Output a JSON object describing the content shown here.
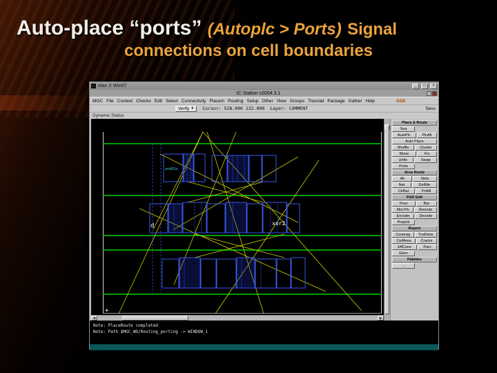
{
  "slide": {
    "title": {
      "main": "Auto-place “ports”",
      "menu_path": "(Autoplc > Ports)",
      "tail": "Signal",
      "line2": "connections on cell boundaries"
    }
  },
  "window": {
    "wm": {
      "title": "elan  X Win07",
      "minimize": "_",
      "maximize": "□",
      "close": "×"
    },
    "app_title": "IC Station v2004.3.1",
    "menu": {
      "items": [
        "MGC",
        "File",
        "Context",
        "Checks",
        "Edit",
        "Select",
        "Connectivity",
        "Placem",
        "Routing",
        "Setup",
        "Other",
        "View",
        "Groups",
        "Translat",
        "Package",
        "Gather",
        "Help"
      ],
      "adk": "ADK"
    },
    "toolbar": {
      "verify": "Verify",
      "dropdown": "▼",
      "cursor": "Cursor: 528.000 132.000",
      "layer": "Layer: COMMENT",
      "session": "Sess"
    },
    "status_row": {
      "label": "Dynamic Status"
    },
    "canvas": {
      "labels": {
        "origin": "+",
        "row1": "and02a",
        "row2_left": "d",
        "row2_right": "xor2"
      }
    },
    "panel": {
      "rows": [
        {
          "style": "header",
          "buttons": [
            "Place & Route"
          ]
        },
        {
          "style": "half",
          "buttons": [
            "Seq"
          ]
        },
        {
          "buttons": [
            "AutoPlc",
            "PlcAll"
          ]
        },
        {
          "buttons": [
            "Auto Place"
          ]
        },
        {
          "buttons": [
            "Shuffle",
            "Cluster"
          ]
        },
        {
          "buttons": [
            "Move",
            "Fix"
          ]
        },
        {
          "buttons": [
            "Unfix",
            "Swap"
          ]
        },
        {
          "style": "half",
          "buttons": [
            "Ports"
          ]
        },
        {
          "style": "header",
          "buttons": [
            "Area Route"
          ]
        },
        {
          "buttons": [
            "All",
            "Nets"
          ]
        },
        {
          "buttons": [
            "Net",
            "DelRte"
          ]
        },
        {
          "buttons": [
            "ClrBar",
            "PrtAll"
          ]
        },
        {
          "style": "header",
          "buttons": [
            "P&R Edit"
          ]
        },
        {
          "buttons": [
            "Pour",
            "Bar"
          ]
        },
        {
          "buttons": [
            "MovTrk",
            "Reroute"
          ]
        },
        {
          "buttons": [
            "Encode",
            "Decode"
          ]
        },
        {
          "style": "half",
          "buttons": [
            "PrepInt"
          ]
        },
        {
          "style": "header",
          "buttons": [
            "Report"
          ]
        },
        {
          "buttons": [
            "Coverag",
            "TrwDens"
          ]
        },
        {
          "buttons": [
            "CellArea",
            "Cracks"
          ]
        },
        {
          "buttons": [
            "EffCons",
            "Pars"
          ]
        },
        {
          "style": "half",
          "buttons": [
            "Elem"
          ]
        },
        {
          "style": "header",
          "buttons": [
            "Palettes"
          ]
        },
        {
          "style": "half",
          "buttons": [
            "…"
          ]
        }
      ]
    },
    "messages": [
      "Note: PlaceRoute completed",
      "Note: Path $MGC_WD/Routing_porting -> WINDOW_1"
    ],
    "scroll": {
      "up": "▲",
      "down": "▼",
      "left": "◄",
      "right": "►"
    }
  }
}
